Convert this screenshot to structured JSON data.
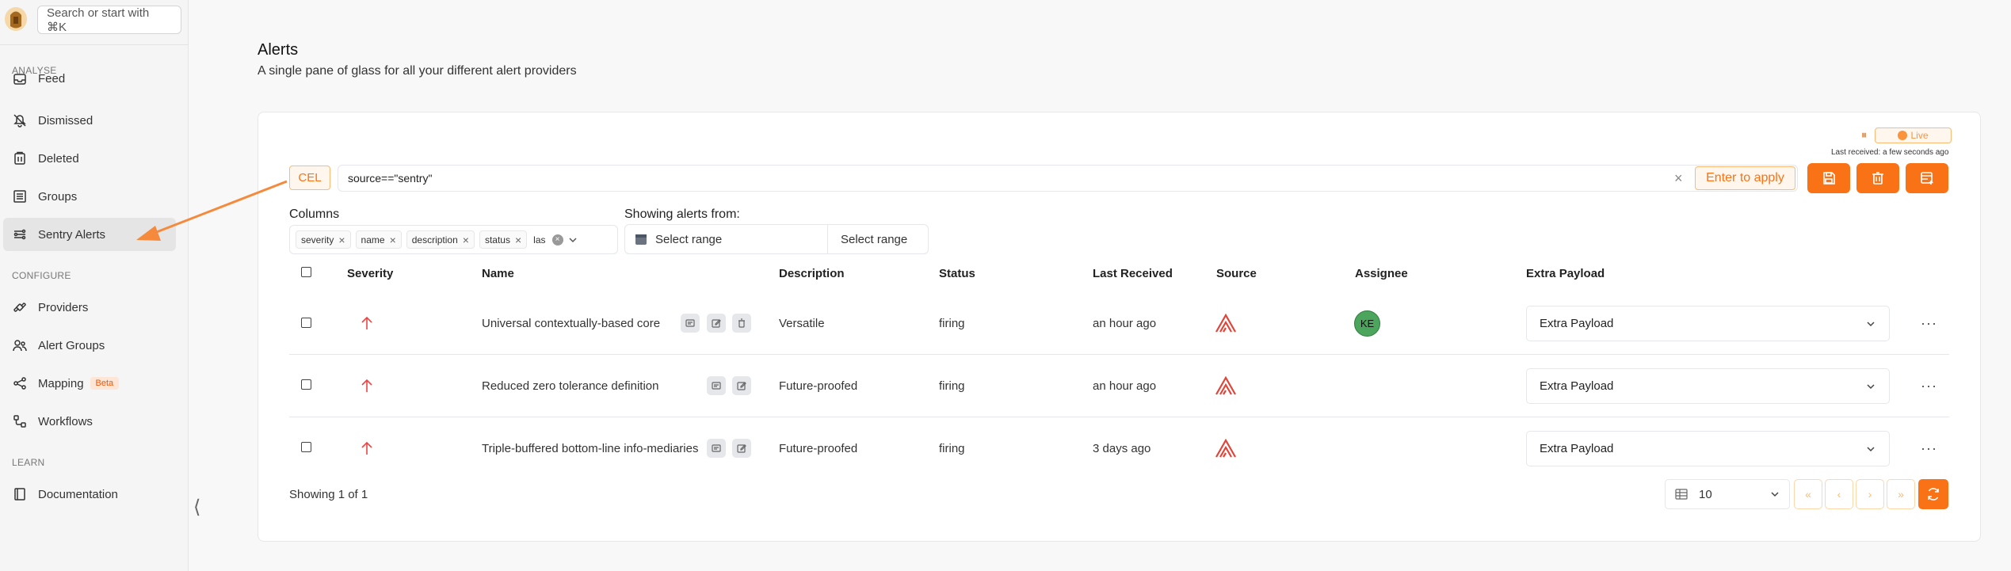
{
  "sidebar": {
    "search_placeholder": "Search or start with ⌘K",
    "sections": {
      "analyse": "ANALYSE",
      "configure": "CONFIGURE",
      "learn": "LEARN"
    },
    "items": [
      {
        "label": "Feed",
        "icon": "inbox-icon"
      },
      {
        "label": "Dismissed",
        "icon": "bell-off-icon"
      },
      {
        "label": "Deleted",
        "icon": "trash-icon"
      },
      {
        "label": "Groups",
        "icon": "groups-icon"
      },
      {
        "label": "Sentry Alerts",
        "icon": "filter-icon",
        "active": true
      },
      {
        "label": "Providers",
        "icon": "plug-icon"
      },
      {
        "label": "Alert Groups",
        "icon": "users-icon"
      },
      {
        "label": "Mapping",
        "icon": "share-icon",
        "badge": "Beta"
      },
      {
        "label": "Workflows",
        "icon": "workflow-icon"
      },
      {
        "label": "Documentation",
        "icon": "book-icon"
      }
    ],
    "collapse_glyph": "⟨"
  },
  "header": {
    "title": "Alerts",
    "subtitle": "A single pane of glass for all your different alert providers"
  },
  "live": {
    "pause_glyph": "⏸",
    "label": "Live",
    "last_received": "Last received: a few seconds ago"
  },
  "filter": {
    "cel_label": "CEL",
    "query": "source==\"sentry\"",
    "clear_glyph": "×",
    "apply_label": "Enter to apply"
  },
  "columns": {
    "label": "Columns",
    "chips": [
      "severity",
      "name",
      "description",
      "status",
      "las"
    ]
  },
  "range": {
    "label": "Showing alerts from:",
    "start_placeholder": "Select range",
    "end_placeholder": "Select range"
  },
  "table": {
    "headers": [
      "Severity",
      "Name",
      "Description",
      "Status",
      "Last Received",
      "Source",
      "Assignee",
      "Extra Payload"
    ],
    "rows": [
      {
        "name": "Universal contextually-based core",
        "description": "Versatile",
        "status": "firing",
        "last_received": "an hour ago",
        "assignee": "KE",
        "payload": "Extra Payload"
      },
      {
        "name": "Reduced zero tolerance definition",
        "description": "Future-proofed",
        "status": "firing",
        "last_received": "an hour ago",
        "assignee": "",
        "payload": "Extra Payload"
      },
      {
        "name": "Triple-buffered bottom-line info-mediaries",
        "description": "Future-proofed",
        "status": "firing",
        "last_received": "3 days ago",
        "assignee": "",
        "payload": "Extra Payload"
      }
    ],
    "more_glyph": "···"
  },
  "footer": {
    "showing": "Showing 1 of 1",
    "page_size": "10",
    "first_glyph": "«",
    "prev_glyph": "‹",
    "next_glyph": "›",
    "last_glyph": "»"
  },
  "colors": {
    "accent": "#f97316",
    "severity_high": "#ef4444",
    "source_sentry": "#e0453a",
    "avatar_bg": "#4ca55c"
  }
}
